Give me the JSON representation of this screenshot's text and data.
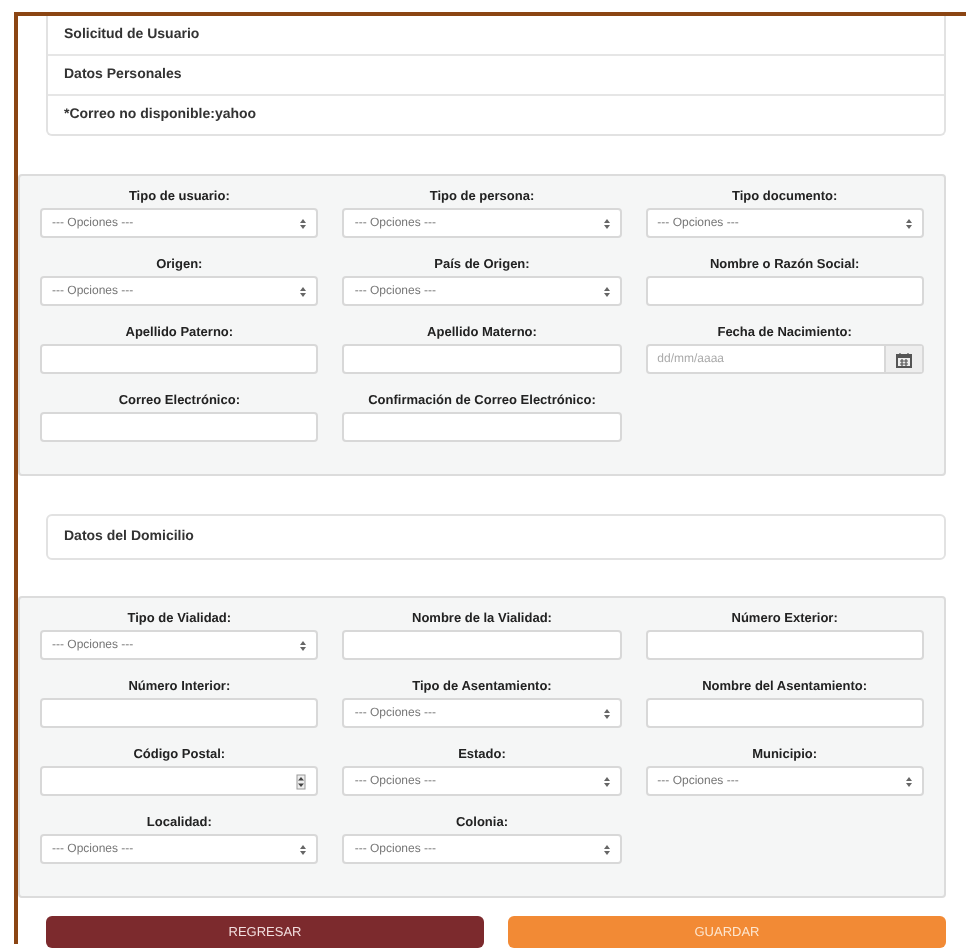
{
  "header_rows": [
    "Solicitud de Usuario",
    "Datos Personales",
    "*Correo no disponible:yahoo"
  ],
  "personal_form": {
    "fields": [
      {
        "label": "Tipo de usuario:",
        "kind": "select",
        "value": "--- Opciones ---"
      },
      {
        "label": "Tipo de persona:",
        "kind": "select",
        "value": "--- Opciones ---"
      },
      {
        "label": "Tipo documento:",
        "kind": "select",
        "value": "--- Opciones ---"
      },
      {
        "label": "Origen:",
        "kind": "select",
        "value": "--- Opciones ---"
      },
      {
        "label": "País de Origen:",
        "kind": "select",
        "value": "--- Opciones ---"
      },
      {
        "label": "Nombre o Razón Social:",
        "kind": "text"
      },
      {
        "label": "Apellido Paterno:",
        "kind": "text"
      },
      {
        "label": "Apellido Materno:",
        "kind": "text"
      },
      {
        "label": "Fecha de Nacimiento:",
        "kind": "date",
        "placeholder": "dd/mm/aaaa"
      },
      {
        "label": "Correo Electrónico:",
        "kind": "text"
      },
      {
        "label": "Confirmación de Correo Electrónico:",
        "kind": "text"
      }
    ]
  },
  "address_header": "Datos del Domicilio",
  "address_form": {
    "fields": [
      {
        "label": "Tipo de Vialidad:",
        "kind": "select",
        "value": "--- Opciones ---"
      },
      {
        "label": "Nombre de la Vialidad:",
        "kind": "text"
      },
      {
        "label": "Número Exterior:",
        "kind": "text"
      },
      {
        "label": "Número Interior:",
        "kind": "text"
      },
      {
        "label": "Tipo de Asentamiento:",
        "kind": "select",
        "value": "--- Opciones ---"
      },
      {
        "label": "Nombre del Asentamiento:",
        "kind": "text"
      },
      {
        "label": "Código Postal:",
        "kind": "number"
      },
      {
        "label": "Estado:",
        "kind": "select",
        "value": "--- Opciones ---"
      },
      {
        "label": "Municipio:",
        "kind": "select",
        "value": "--- Opciones ---"
      },
      {
        "label": "Localidad:",
        "kind": "select",
        "value": "--- Opciones ---"
      },
      {
        "label": "Colonia:",
        "kind": "select",
        "value": "--- Opciones ---"
      }
    ]
  },
  "buttons": [
    {
      "label": "REGRESAR",
      "kind": "back"
    },
    {
      "label": "GUARDAR",
      "kind": "save"
    }
  ]
}
